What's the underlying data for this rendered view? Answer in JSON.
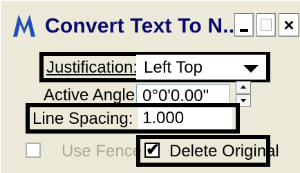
{
  "window": {
    "title": "Convert Text To N...",
    "icon": "microstation-m-icon",
    "controls": [
      "minimize",
      "maximize",
      "close"
    ],
    "close_glyph": "×"
  },
  "form": {
    "justification": {
      "label": "Justification:",
      "value": "Left Top"
    },
    "active_angle": {
      "label": "Active Angle",
      "value": "0°0'0.00\""
    },
    "line_spacing": {
      "label": "Line Spacing:",
      "value": "1.000"
    },
    "use_fence": {
      "label": "Use Fence",
      "checked": false,
      "enabled": false
    },
    "delete_original": {
      "label": "Delete Original",
      "checked": true,
      "enabled": true,
      "check_glyph": "✔"
    }
  },
  "colors": {
    "title_text": "#0a0a6e",
    "dialog_bg": "#ece9d8",
    "icon_blue": "#1f4fb8",
    "disabled_text": "#aca899"
  }
}
